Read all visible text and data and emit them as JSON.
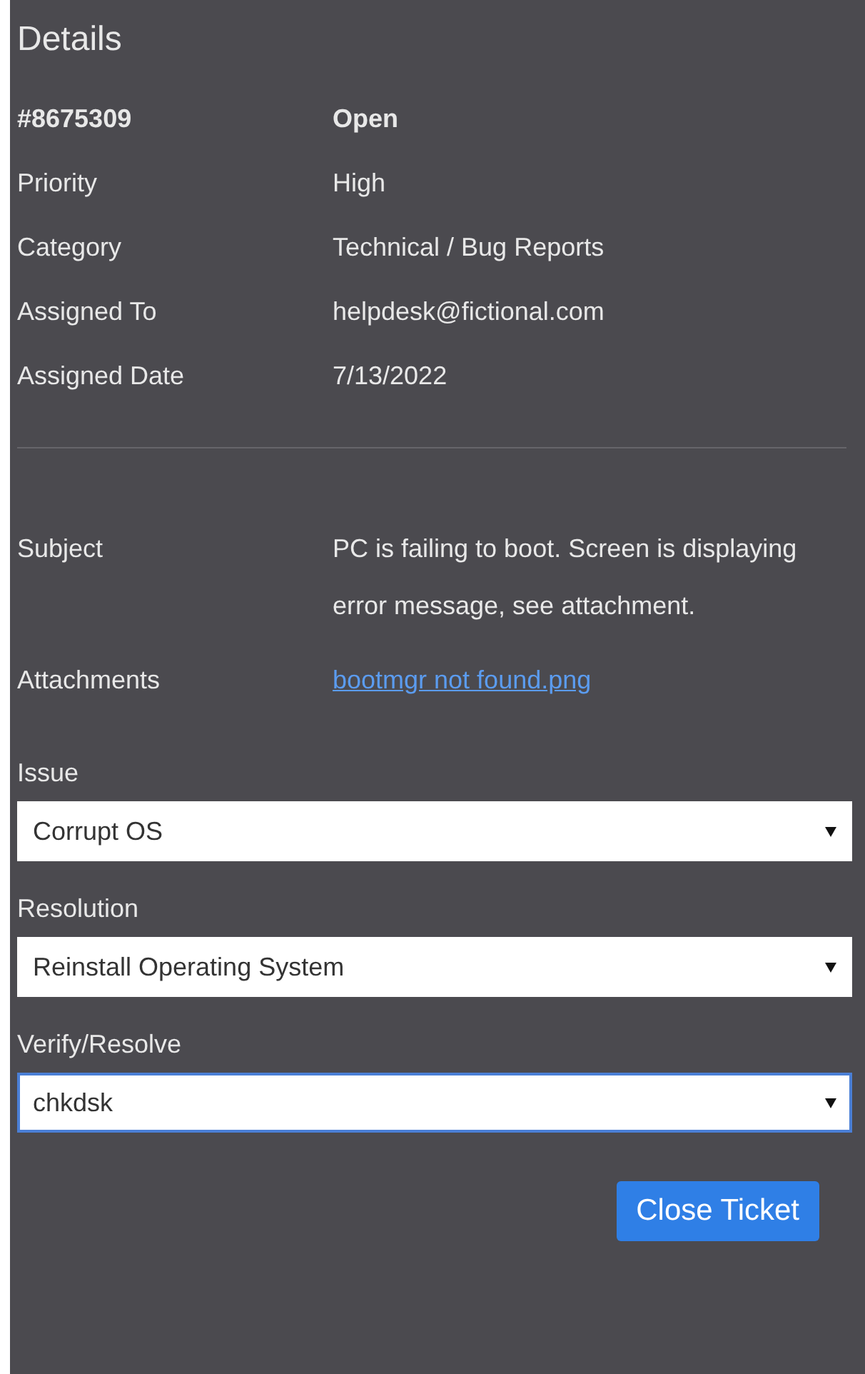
{
  "title": "Details",
  "header": {
    "id": "#8675309",
    "status": "Open"
  },
  "fields": [
    {
      "label": "Priority",
      "value": "High"
    },
    {
      "label": "Category",
      "value": "Technical / Bug Reports"
    },
    {
      "label": "Assigned To",
      "value": "helpdesk@fictional.com"
    },
    {
      "label": "Assigned Date",
      "value": "7/13/2022"
    }
  ],
  "subject": {
    "label": "Subject",
    "value": "PC is failing to boot. Screen is displaying error message, see attachment."
  },
  "attachments": {
    "label": "Attachments",
    "link": "bootmgr not found.png"
  },
  "selects": [
    {
      "label": "Issue",
      "value": "Corrupt OS",
      "focused": false
    },
    {
      "label": "Resolution",
      "value": "Reinstall Operating System",
      "focused": false
    },
    {
      "label": "Verify/Resolve",
      "value": "chkdsk",
      "focused": true
    }
  ],
  "button": "Close Ticket"
}
